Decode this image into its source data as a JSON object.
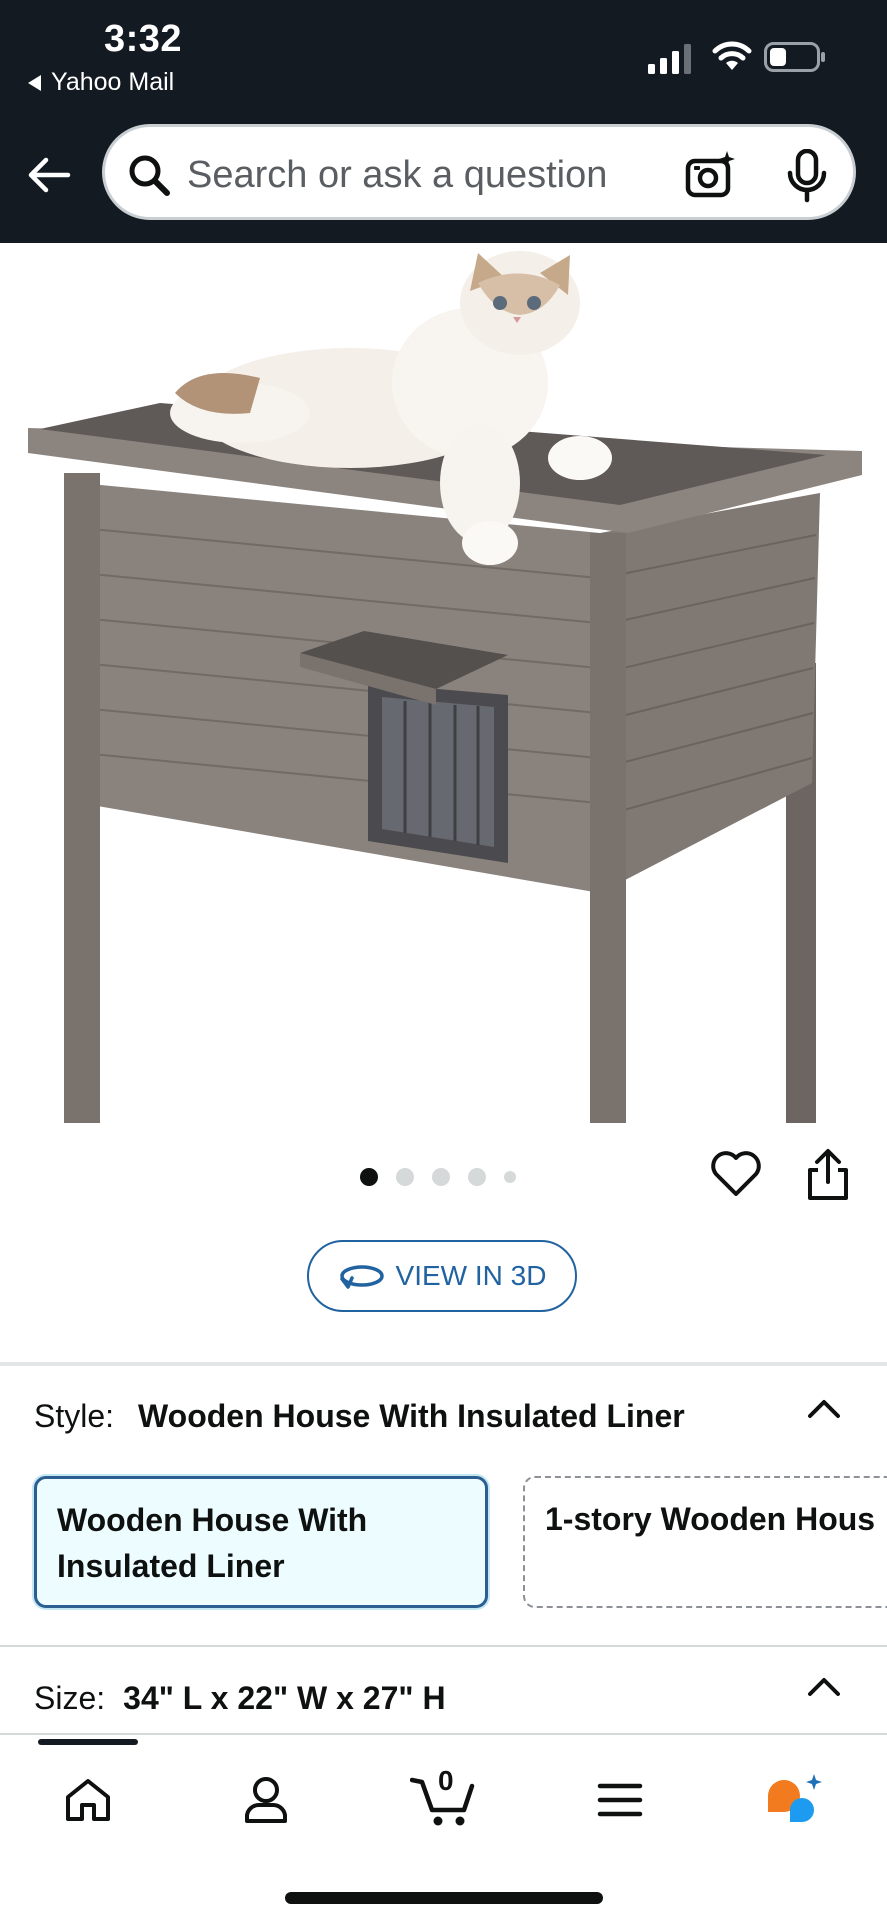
{
  "status_bar": {
    "time": "3:32",
    "back_app": "Yahoo Mail"
  },
  "search": {
    "placeholder": "Search or ask a question"
  },
  "gallery": {
    "image_count": 5,
    "active_index": 0
  },
  "view_3d": {
    "label": "VIEW IN 3D"
  },
  "style": {
    "label": "Style:",
    "value": "Wooden House With Insulated Liner",
    "options": [
      {
        "label": "Wooden House With Insulated Liner",
        "selected": true
      },
      {
        "label": "1-story Wooden Hous",
        "selected": false
      }
    ]
  },
  "size": {
    "label": "Size:",
    "value": "34\" L x 22\" W x 27\" H"
  },
  "bottom_nav": {
    "cart_count": "0",
    "items": [
      "home-icon",
      "account-icon",
      "cart-icon",
      "menu-icon",
      "ai-assistant-icon"
    ]
  },
  "colors": {
    "header_bg": "#131a22",
    "link_blue": "#2162a1",
    "selected_border": "#2c5e8f",
    "selected_bg": "#edfdff",
    "ai_orange": "#f27b1f",
    "ai_blue": "#1d9bf0"
  }
}
